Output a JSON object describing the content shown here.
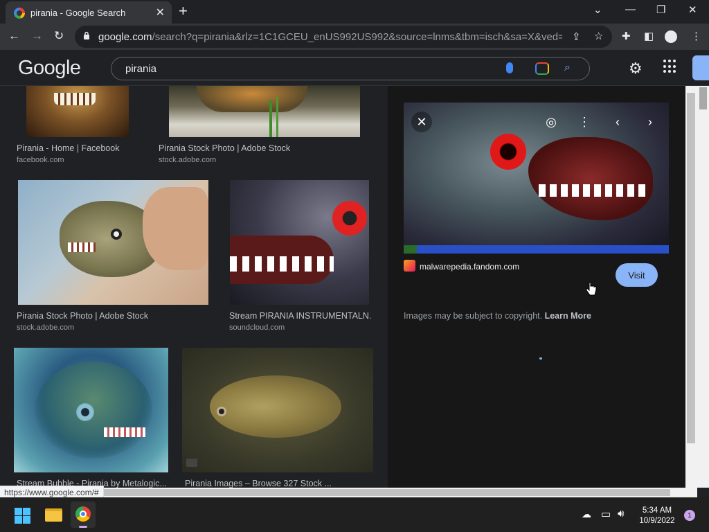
{
  "browser": {
    "tab_title": "pirania - Google Search",
    "url_domain": "google.com",
    "url_path": "/search?q=pirania&rlz=1C1GCEU_enUS992US992&source=lnms&tbm=isch&sa=X&ved=2ahU...",
    "status_url": "https://www.google.com/#"
  },
  "google": {
    "logo": "Google",
    "query": "pirania"
  },
  "results": [
    {
      "caption": "Pirania - Home | Facebook",
      "source": "facebook.com"
    },
    {
      "caption": "Pirania Stock Photo | Adobe Stock",
      "source": "stock.adobe.com"
    },
    {
      "caption": "Pirania Stock Photo | Adobe Stock",
      "source": "stock.adobe.com"
    },
    {
      "caption": "Stream PIRANIA INSTRUMENTALN...",
      "source": "soundcloud.com"
    },
    {
      "caption": "Stream Bubble - Pirania by Metalogic...",
      "source": ""
    },
    {
      "caption": "Pirania Images – Browse 327 Stock ...",
      "source": ""
    }
  ],
  "preview": {
    "site": "malwarepedia.fandom.com",
    "visit_label": "Visit",
    "copyright_text": "Images may be subject to copyright.",
    "learn_more": "Learn More"
  },
  "taskbar": {
    "time": "5:34 AM",
    "date": "10/9/2022",
    "notification_count": "1"
  },
  "colors": {
    "accent": "#8ab4f8",
    "background": "#202124",
    "preview_bg": "#171717"
  }
}
